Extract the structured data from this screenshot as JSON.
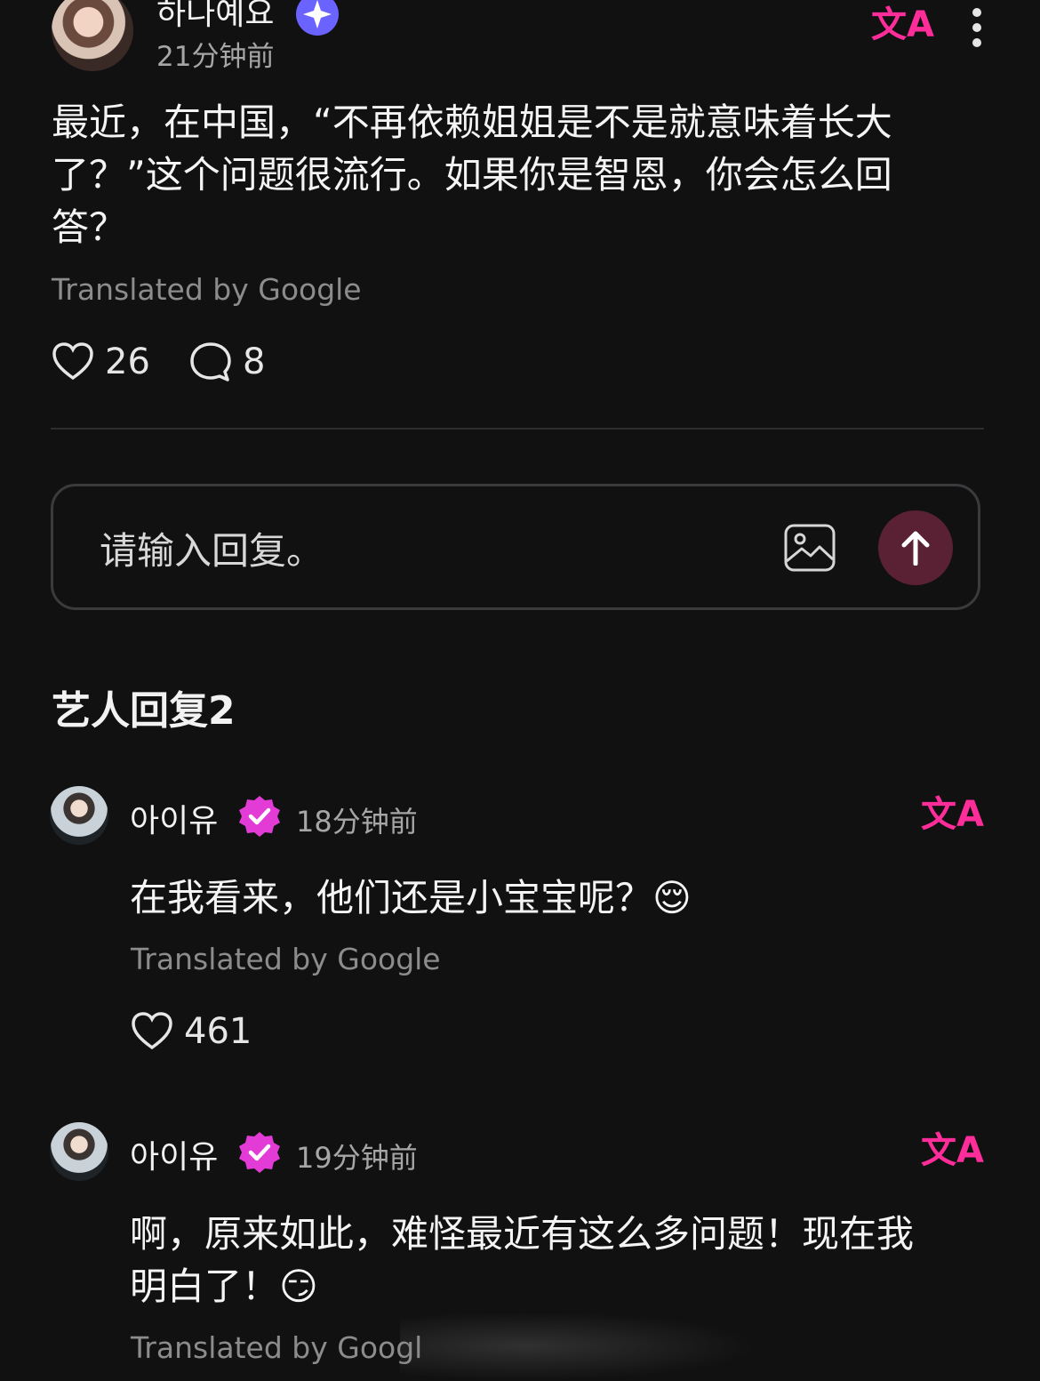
{
  "post": {
    "author": "하나예요",
    "time": "21分钟前",
    "text_lines": [
      "最近，在中国，“不再依赖姐姐是不是就意味着长大",
      "了？”这个问题很流行。如果你是智恩，你会怎么回",
      "答？"
    ],
    "translated_by": "Translated by Google",
    "likes": "26",
    "comments": "8"
  },
  "reply_box": {
    "placeholder": "请输入回复。"
  },
  "section_title": "艺人回复2",
  "replies": [
    {
      "author": "아이유",
      "time": "18分钟前",
      "text_lines": [
        "在我看来，他们还是小宝宝呢？😌"
      ],
      "translated_by": "Translated by Google",
      "likes": "461"
    },
    {
      "author": "아이유",
      "time": "19分钟前",
      "text_lines": [
        "啊，原来如此，难怪最近有这么多问题！现在我",
        "明白了！😏"
      ],
      "translated_by": "Translated by Googl"
    }
  ],
  "icons": {
    "translate": "translate-icon",
    "more": "more-vertical-icon",
    "heart": "heart-icon",
    "comment": "comment-bubble-icon",
    "image": "image-icon",
    "send": "arrow-up-icon",
    "verified": "verified-badge-icon"
  },
  "colors": {
    "background": "#111112",
    "accent_pink": "#ff2d9a",
    "send_button": "#5a2134",
    "verified_blue": "#6b63ff",
    "verified_pink": "#e33bd6"
  }
}
